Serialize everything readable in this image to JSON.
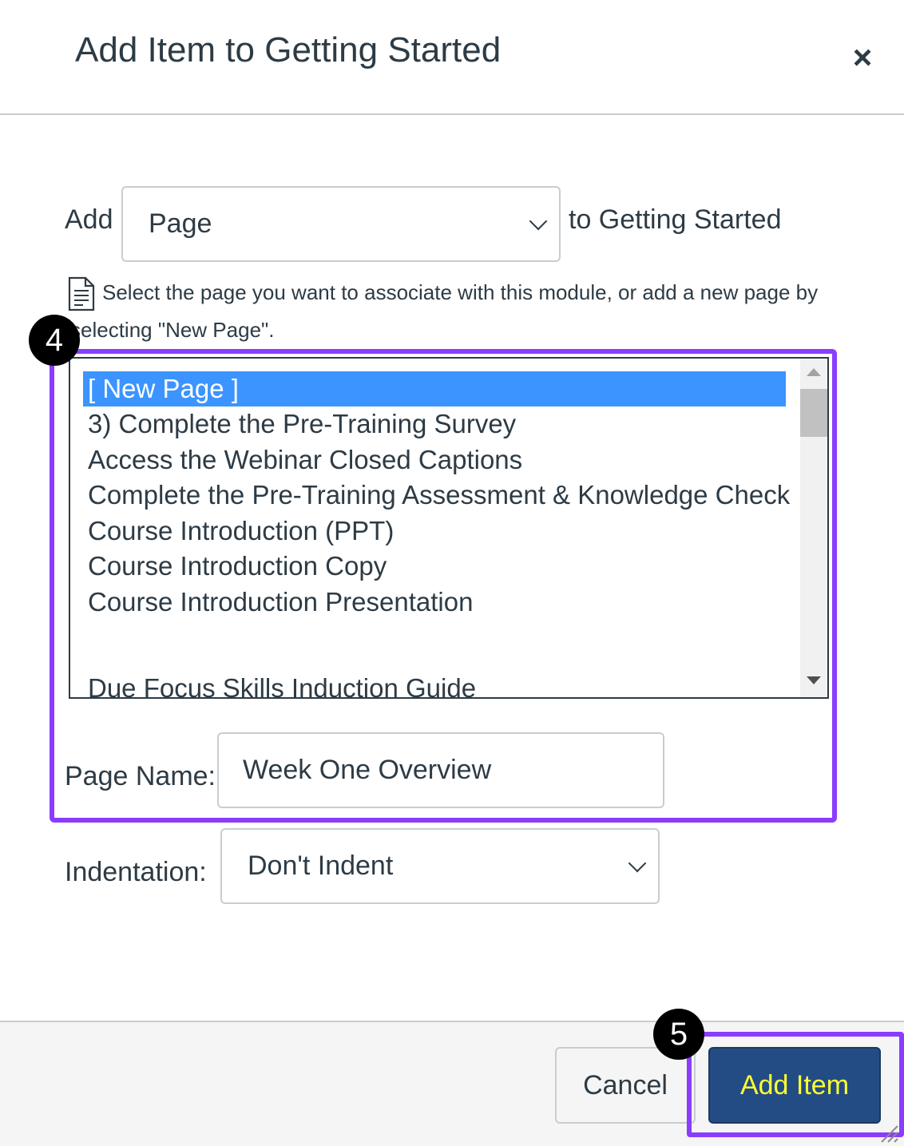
{
  "dialog": {
    "title": "Add Item to Getting Started",
    "close_icon": "×"
  },
  "add_row": {
    "add_label": "Add",
    "item_type": "Page",
    "to_label": "to Getting Started"
  },
  "instruction": {
    "icon": "document-icon",
    "text": "Select the page you want to associate with this module, or add a new page by selecting \"New Page\"."
  },
  "page_list": {
    "items": [
      "[ New Page ]",
      "3) Complete the Pre-Training Survey",
      "Access the Webinar Closed Captions",
      "Complete the Pre-Training Assessment & Knowledge Check",
      "Course Introduction (PPT)",
      "Course Introduction Copy",
      "Course Introduction Presentation",
      "Due Focus Skills Induction Guide"
    ],
    "selected_index": 0
  },
  "page_name": {
    "label": "Page Name:",
    "value": "Week One Overview"
  },
  "indentation": {
    "label": "Indentation:",
    "value": "Don't Indent"
  },
  "footer": {
    "cancel_label": "Cancel",
    "add_item_label": "Add Item"
  },
  "callouts": {
    "step_4": "4",
    "step_5": "5"
  },
  "colors": {
    "callout": "#8b3dff",
    "selected_item": "#3b94ff",
    "primary_button": "#234c84",
    "primary_button_text": "#ffff33"
  }
}
